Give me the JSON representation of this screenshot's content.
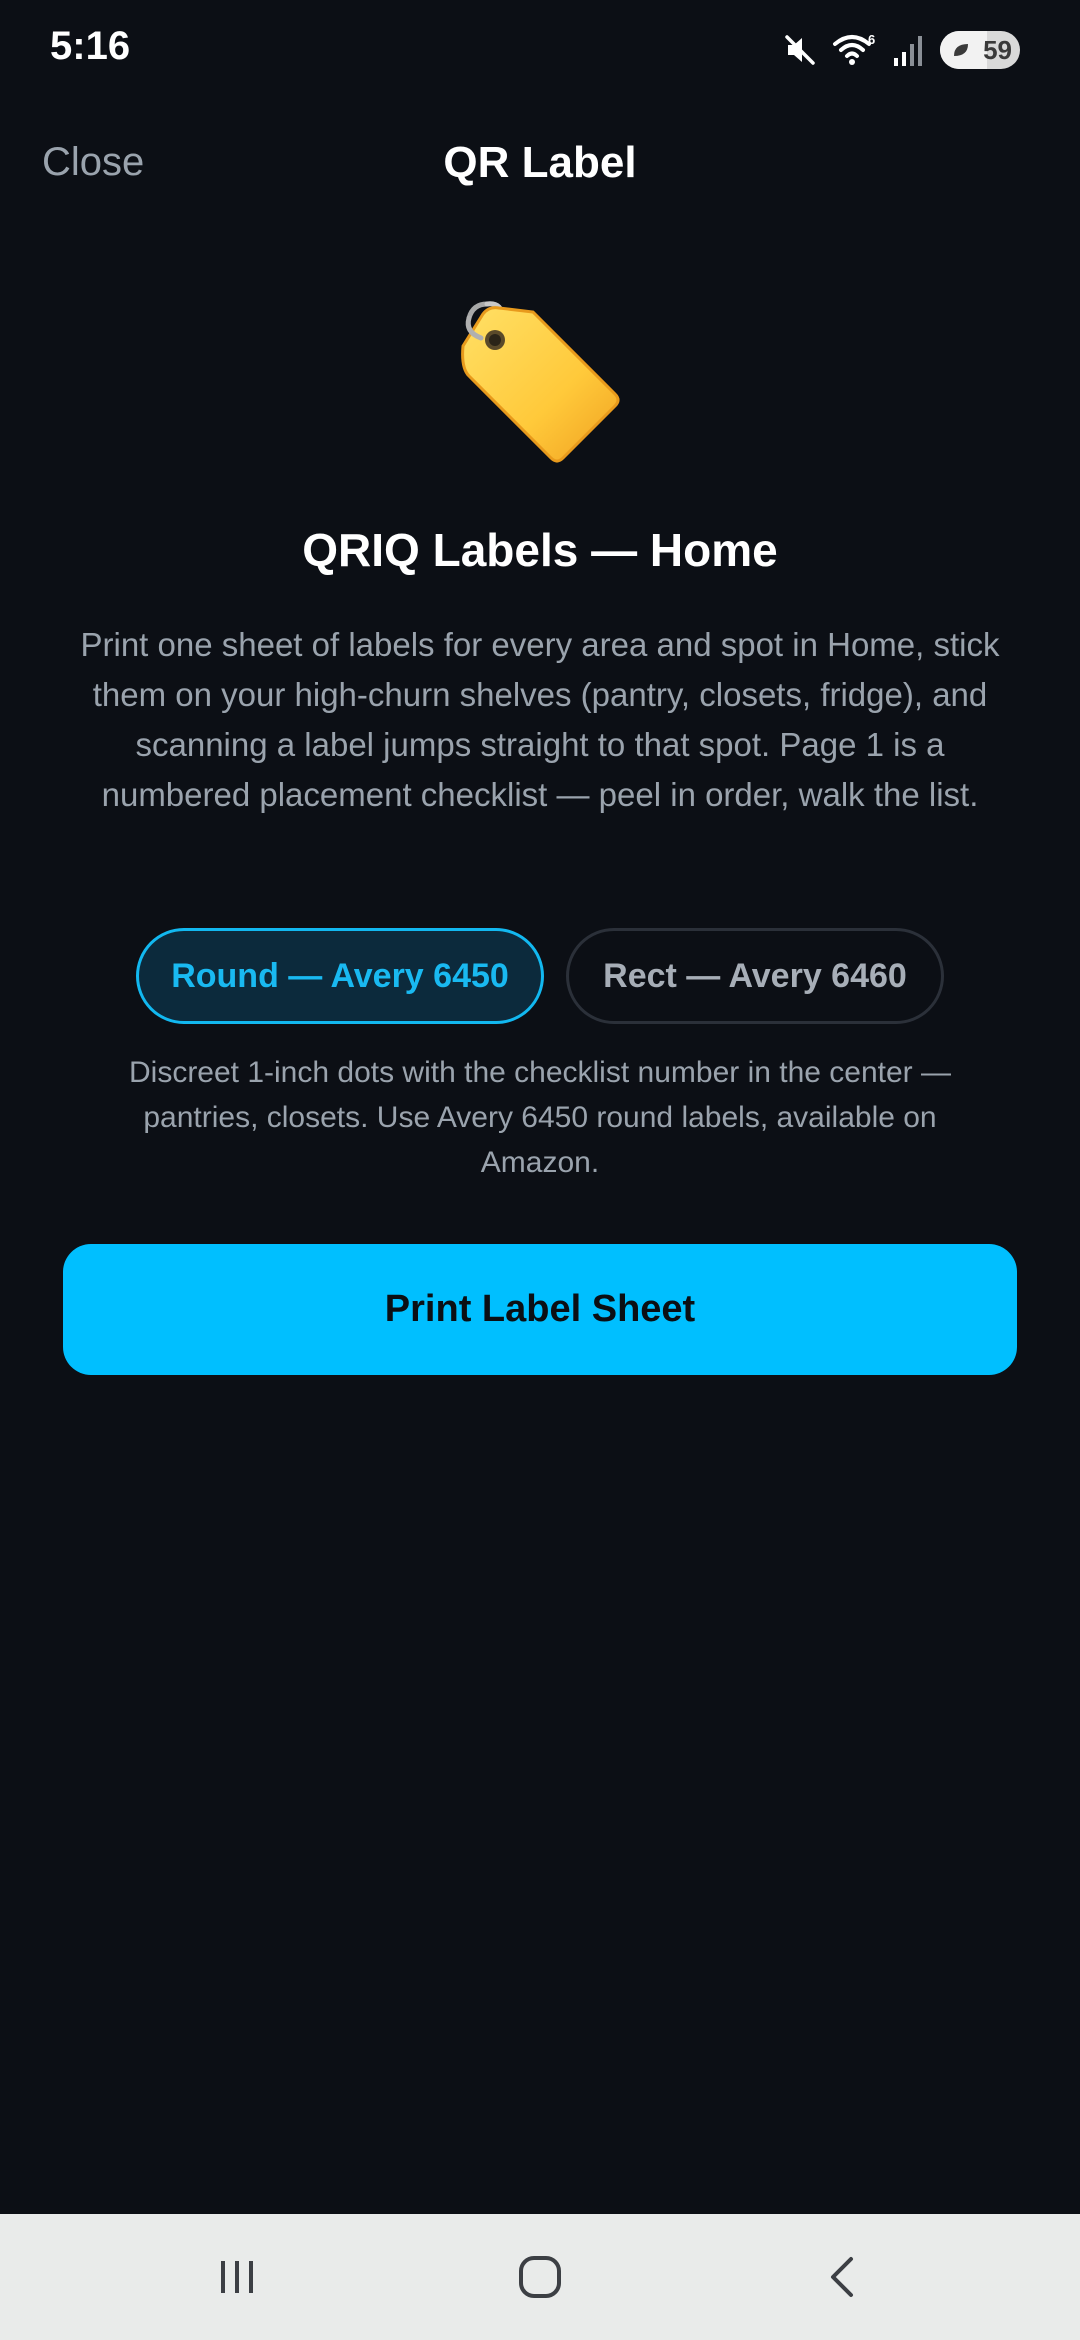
{
  "status_bar": {
    "time": "5:16",
    "battery_level": "59",
    "icons": [
      "mute-icon",
      "wifi-icon",
      "signal-icon",
      "battery-icon"
    ]
  },
  "header": {
    "close_label": "Close",
    "title": "QR Label"
  },
  "hero": {
    "icon": "label-tag-icon",
    "title": "QRIQ Labels — Home",
    "description": "Print one sheet of labels for every area and spot in Home, stick them on your high-churn shelves (pantry, closets, fridge), and scanning a label jumps straight to that spot. Page 1 is a numbered placement checklist — peel in order, walk the list."
  },
  "label_options": [
    {
      "label": "Round — Avery 6450",
      "selected": true
    },
    {
      "label": "Rect — Avery 6460",
      "selected": false
    }
  ],
  "option_description": "Discreet 1-inch dots with the checklist number in the center — pantries, closets. Use Avery 6450 round labels, available on Amazon.",
  "print_button_label": "Print Label Sheet",
  "nav_bar": {
    "buttons": [
      "recents-icon",
      "home-icon",
      "back-icon"
    ]
  },
  "colors": {
    "background": "#0c0f15",
    "accent": "#00bfff",
    "muted_text": "#9aa3ad"
  }
}
